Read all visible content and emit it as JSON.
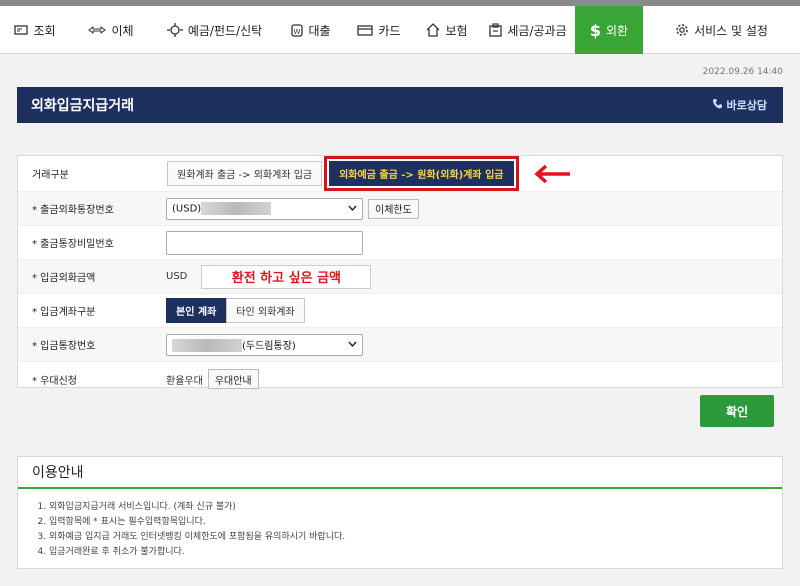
{
  "nav": [
    {
      "label": "조회",
      "icon": "inquiry-icon"
    },
    {
      "label": "이체",
      "icon": "transfer-icon"
    },
    {
      "label": "예금/펀드/신탁",
      "icon": "deposit-icon"
    },
    {
      "label": "대출",
      "icon": "loan-icon"
    },
    {
      "label": "카드",
      "icon": "card-icon"
    },
    {
      "label": "보험",
      "icon": "insurance-icon"
    },
    {
      "label": "세금/공과금",
      "icon": "tax-icon"
    },
    {
      "label": "외환",
      "icon": "dollar-icon",
      "active": true
    },
    {
      "label": "서비스 및 설정",
      "icon": "gear-icon"
    }
  ],
  "timestamp": "2022.09.26 14:40",
  "page_title": "외화입금지급거래",
  "consult_label": "바로상담",
  "form": {
    "transaction_type": {
      "label": "거래구분",
      "options": [
        "원화계좌 출금 -> 외화계좌 입금",
        "외화예금 출금 -> 원화(외화)계좌 입금"
      ],
      "selected_index": 1
    },
    "withdraw_account": {
      "label": "* 출금외화통장번호",
      "value": "(USD)",
      "limit_button": "이체한도"
    },
    "withdraw_password": {
      "label": "* 출금통장비밀번호",
      "value": ""
    },
    "deposit_amount": {
      "label": "* 입금외화금액",
      "currency": "USD",
      "value": "환전 하고 싶은 금액"
    },
    "deposit_account_type": {
      "label": "* 입금계좌구분",
      "options": [
        "본인 계좌",
        "타인 외화계좌"
      ],
      "selected_index": 0
    },
    "deposit_account": {
      "label": "* 입금통장번호",
      "value": "(두드림통장)"
    },
    "preferential": {
      "label": "* 우대신청",
      "text": "환율우대",
      "button": "우대안내"
    }
  },
  "confirm_label": "확인",
  "info": {
    "title": "이용안내",
    "items": [
      "외화입금지급거래 서비스입니다. (계좌 신규 불가)",
      "입력항목에 * 표시는 필수입력항목입니다.",
      "외화예금 입지급 거래도 인터넷뱅킹 이체한도에 포함됨을 유의하시기 바랍니다.",
      "입금거래완료 후 취소가 불가합니다."
    ]
  },
  "colors": {
    "nav_active": "#3aa537",
    "title_bar": "#1e3060",
    "highlight_box": "#d4131b",
    "callout_text": "#e0141d",
    "confirm": "#2c9a3a"
  }
}
